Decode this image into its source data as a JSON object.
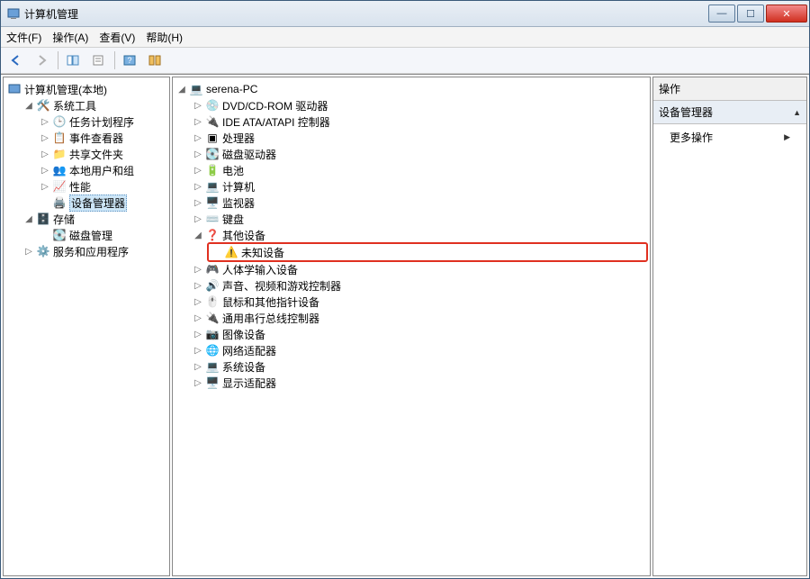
{
  "window": {
    "title": "计算机管理"
  },
  "menu": {
    "file": "文件(F)",
    "action": "操作(A)",
    "view": "查看(V)",
    "help": "帮助(H)"
  },
  "left_tree": {
    "root": "计算机管理(本地)",
    "systools": "系统工具",
    "task": "任务计划程序",
    "event": "事件查看器",
    "shared": "共享文件夹",
    "users": "本地用户和组",
    "perf": "性能",
    "devmgr": "设备管理器",
    "storage": "存储",
    "diskmgr": "磁盘管理",
    "services": "服务和应用程序"
  },
  "mid_tree": {
    "root": "serena-PC",
    "dvd": "DVD/CD-ROM 驱动器",
    "ide": "IDE ATA/ATAPI 控制器",
    "cpu": "处理器",
    "diskdrv": "磁盘驱动器",
    "battery": "电池",
    "computer": "计算机",
    "monitor": "监视器",
    "keyboard": "键盘",
    "other": "其他设备",
    "unknown": "未知设备",
    "hid": "人体学输入设备",
    "sound": "声音、视频和游戏控制器",
    "mouse": "鼠标和其他指针设备",
    "usb": "通用串行总线控制器",
    "imaging": "图像设备",
    "net": "网络适配器",
    "sysdev": "系统设备",
    "display": "显示适配器"
  },
  "right": {
    "header": "操作",
    "section": "设备管理器",
    "more": "更多操作"
  }
}
